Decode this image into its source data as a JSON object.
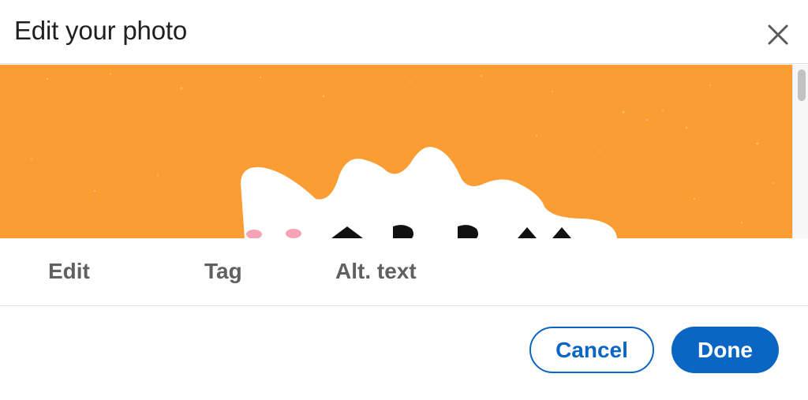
{
  "dialog": {
    "title": "Edit your photo",
    "close_icon": "close-icon"
  },
  "image": {
    "description_icon": "photo-preview",
    "background_color": "#fc9d33"
  },
  "tabs": [
    {
      "label": "Edit"
    },
    {
      "label": "Tag"
    },
    {
      "label": "Alt. text"
    }
  ],
  "footer": {
    "cancel_label": "Cancel",
    "done_label": "Done"
  },
  "colors": {
    "accent": "#0a66c2",
    "tab_text": "#606060"
  }
}
